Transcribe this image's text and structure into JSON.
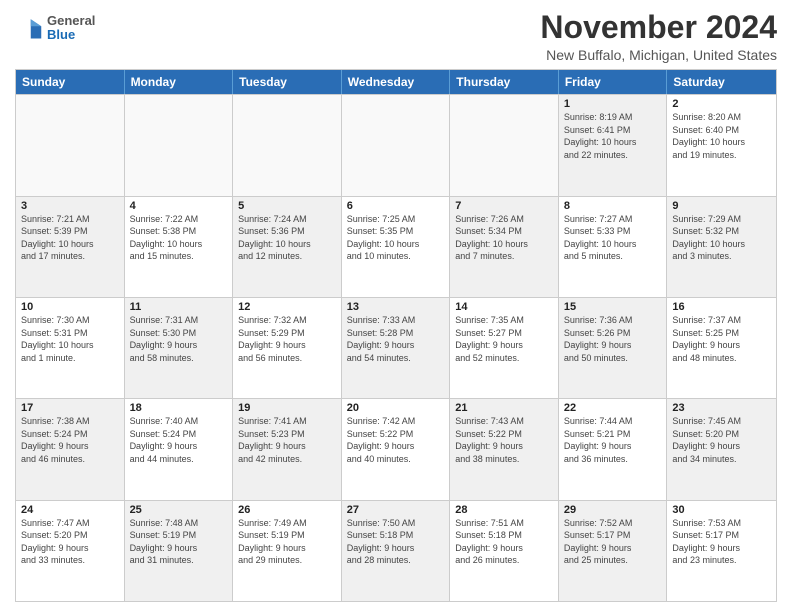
{
  "app": {
    "name": "General Blue",
    "logo_line1": "General",
    "logo_line2": "Blue"
  },
  "header": {
    "month_title": "November 2024",
    "location": "New Buffalo, Michigan, United States"
  },
  "calendar": {
    "days_of_week": [
      "Sunday",
      "Monday",
      "Tuesday",
      "Wednesday",
      "Thursday",
      "Friday",
      "Saturday"
    ],
    "rows": [
      {
        "cells": [
          {
            "day": "",
            "empty": true
          },
          {
            "day": "",
            "empty": true
          },
          {
            "day": "",
            "empty": true
          },
          {
            "day": "",
            "empty": true
          },
          {
            "day": "",
            "empty": true
          },
          {
            "day": "1",
            "info": "Sunrise: 8:19 AM\nSunset: 6:41 PM\nDaylight: 10 hours\nand 22 minutes.",
            "shaded": true
          },
          {
            "day": "2",
            "info": "Sunrise: 8:20 AM\nSunset: 6:40 PM\nDaylight: 10 hours\nand 19 minutes.",
            "shaded": false
          }
        ]
      },
      {
        "cells": [
          {
            "day": "3",
            "info": "Sunrise: 7:21 AM\nSunset: 5:39 PM\nDaylight: 10 hours\nand 17 minutes.",
            "shaded": true
          },
          {
            "day": "4",
            "info": "Sunrise: 7:22 AM\nSunset: 5:38 PM\nDaylight: 10 hours\nand 15 minutes.",
            "shaded": false
          },
          {
            "day": "5",
            "info": "Sunrise: 7:24 AM\nSunset: 5:36 PM\nDaylight: 10 hours\nand 12 minutes.",
            "shaded": true
          },
          {
            "day": "6",
            "info": "Sunrise: 7:25 AM\nSunset: 5:35 PM\nDaylight: 10 hours\nand 10 minutes.",
            "shaded": false
          },
          {
            "day": "7",
            "info": "Sunrise: 7:26 AM\nSunset: 5:34 PM\nDaylight: 10 hours\nand 7 minutes.",
            "shaded": true
          },
          {
            "day": "8",
            "info": "Sunrise: 7:27 AM\nSunset: 5:33 PM\nDaylight: 10 hours\nand 5 minutes.",
            "shaded": false
          },
          {
            "day": "9",
            "info": "Sunrise: 7:29 AM\nSunset: 5:32 PM\nDaylight: 10 hours\nand 3 minutes.",
            "shaded": true
          }
        ]
      },
      {
        "cells": [
          {
            "day": "10",
            "info": "Sunrise: 7:30 AM\nSunset: 5:31 PM\nDaylight: 10 hours\nand 1 minute.",
            "shaded": false
          },
          {
            "day": "11",
            "info": "Sunrise: 7:31 AM\nSunset: 5:30 PM\nDaylight: 9 hours\nand 58 minutes.",
            "shaded": true
          },
          {
            "day": "12",
            "info": "Sunrise: 7:32 AM\nSunset: 5:29 PM\nDaylight: 9 hours\nand 56 minutes.",
            "shaded": false
          },
          {
            "day": "13",
            "info": "Sunrise: 7:33 AM\nSunset: 5:28 PM\nDaylight: 9 hours\nand 54 minutes.",
            "shaded": true
          },
          {
            "day": "14",
            "info": "Sunrise: 7:35 AM\nSunset: 5:27 PM\nDaylight: 9 hours\nand 52 minutes.",
            "shaded": false
          },
          {
            "day": "15",
            "info": "Sunrise: 7:36 AM\nSunset: 5:26 PM\nDaylight: 9 hours\nand 50 minutes.",
            "shaded": true
          },
          {
            "day": "16",
            "info": "Sunrise: 7:37 AM\nSunset: 5:25 PM\nDaylight: 9 hours\nand 48 minutes.",
            "shaded": false
          }
        ]
      },
      {
        "cells": [
          {
            "day": "17",
            "info": "Sunrise: 7:38 AM\nSunset: 5:24 PM\nDaylight: 9 hours\nand 46 minutes.",
            "shaded": true
          },
          {
            "day": "18",
            "info": "Sunrise: 7:40 AM\nSunset: 5:24 PM\nDaylight: 9 hours\nand 44 minutes.",
            "shaded": false
          },
          {
            "day": "19",
            "info": "Sunrise: 7:41 AM\nSunset: 5:23 PM\nDaylight: 9 hours\nand 42 minutes.",
            "shaded": true
          },
          {
            "day": "20",
            "info": "Sunrise: 7:42 AM\nSunset: 5:22 PM\nDaylight: 9 hours\nand 40 minutes.",
            "shaded": false
          },
          {
            "day": "21",
            "info": "Sunrise: 7:43 AM\nSunset: 5:22 PM\nDaylight: 9 hours\nand 38 minutes.",
            "shaded": true
          },
          {
            "day": "22",
            "info": "Sunrise: 7:44 AM\nSunset: 5:21 PM\nDaylight: 9 hours\nand 36 minutes.",
            "shaded": false
          },
          {
            "day": "23",
            "info": "Sunrise: 7:45 AM\nSunset: 5:20 PM\nDaylight: 9 hours\nand 34 minutes.",
            "shaded": true
          }
        ]
      },
      {
        "cells": [
          {
            "day": "24",
            "info": "Sunrise: 7:47 AM\nSunset: 5:20 PM\nDaylight: 9 hours\nand 33 minutes.",
            "shaded": false
          },
          {
            "day": "25",
            "info": "Sunrise: 7:48 AM\nSunset: 5:19 PM\nDaylight: 9 hours\nand 31 minutes.",
            "shaded": true
          },
          {
            "day": "26",
            "info": "Sunrise: 7:49 AM\nSunset: 5:19 PM\nDaylight: 9 hours\nand 29 minutes.",
            "shaded": false
          },
          {
            "day": "27",
            "info": "Sunrise: 7:50 AM\nSunset: 5:18 PM\nDaylight: 9 hours\nand 28 minutes.",
            "shaded": true
          },
          {
            "day": "28",
            "info": "Sunrise: 7:51 AM\nSunset: 5:18 PM\nDaylight: 9 hours\nand 26 minutes.",
            "shaded": false
          },
          {
            "day": "29",
            "info": "Sunrise: 7:52 AM\nSunset: 5:17 PM\nDaylight: 9 hours\nand 25 minutes.",
            "shaded": true
          },
          {
            "day": "30",
            "info": "Sunrise: 7:53 AM\nSunset: 5:17 PM\nDaylight: 9 hours\nand 23 minutes.",
            "shaded": false
          }
        ]
      }
    ]
  }
}
